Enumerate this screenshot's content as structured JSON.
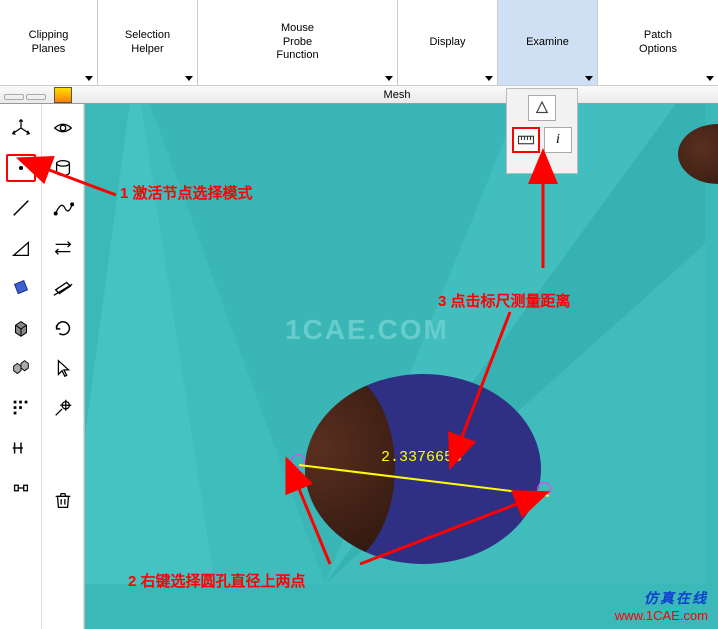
{
  "toolbar": {
    "clipping_planes": "Clipping\nPlanes",
    "selection_helper": "Selection\nHelper",
    "mouse_probe": "Mouse\nProbe\nFunction",
    "display": "Display",
    "examine": "Examine",
    "patch_options": "Patch\nOptions"
  },
  "mesh_bar": {
    "title": "Mesh"
  },
  "popup": {
    "info_label": "i"
  },
  "measurement": {
    "value": "2.3376656"
  },
  "annotations": {
    "a1": "1 激活节点选择模式",
    "a2": "2 右键选择圆孔直径上两点",
    "a3": "3 点击标尺测量距离"
  },
  "watermark": "1CAE.COM",
  "brand": {
    "cn": "仿真在线",
    "url": "www.1CAE.com"
  }
}
